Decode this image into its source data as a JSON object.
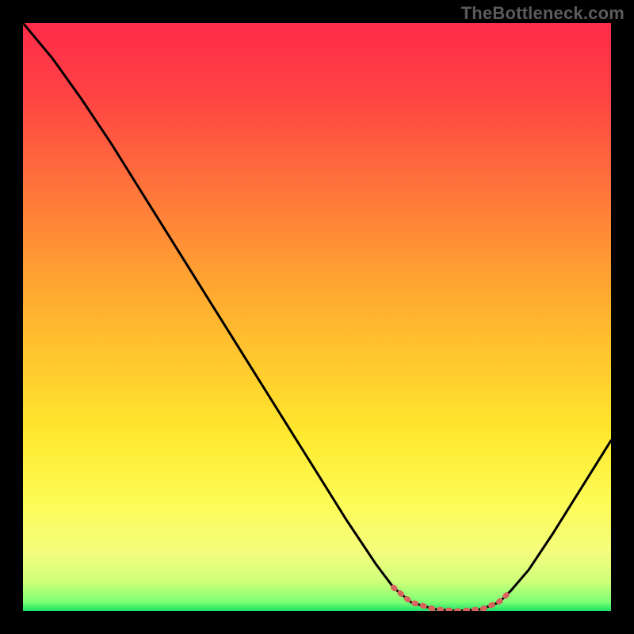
{
  "watermark": "TheBottleneck.com",
  "chart_data": {
    "type": "line",
    "title": "",
    "xlabel": "",
    "ylabel": "",
    "xlim": [
      0,
      100
    ],
    "ylim": [
      0,
      100
    ],
    "grid": false,
    "x": [
      0,
      5,
      10,
      15,
      20,
      25,
      30,
      35,
      40,
      45,
      50,
      55,
      60,
      63,
      66,
      70,
      74,
      78,
      81,
      83,
      86,
      90,
      95,
      100
    ],
    "y": [
      100,
      94,
      87,
      79.5,
      71.5,
      63.5,
      55.5,
      47.5,
      39.5,
      31.5,
      23.5,
      15.5,
      8,
      4,
      1.5,
      0.3,
      0.0,
      0.3,
      1.5,
      3.5,
      7,
      13,
      21,
      29
    ],
    "note": "Values are approximate readings from an unlabeled gradient chart; y=0 at bottom, y=100 at top; x=0 at left, x=100 at right.",
    "flat_segment": {
      "x_start": 63,
      "x_end": 83,
      "color": "#d9645e",
      "style": "dotted"
    },
    "gradient_stops": [
      {
        "offset": 0.0,
        "color": "#ff2b4a"
      },
      {
        "offset": 0.12,
        "color": "#ff4244"
      },
      {
        "offset": 0.25,
        "color": "#ff6a3d"
      },
      {
        "offset": 0.4,
        "color": "#ff9933"
      },
      {
        "offset": 0.55,
        "color": "#ffc22e"
      },
      {
        "offset": 0.7,
        "color": "#ffe92e"
      },
      {
        "offset": 0.82,
        "color": "#fdfc58"
      },
      {
        "offset": 0.9,
        "color": "#f4fd7d"
      },
      {
        "offset": 0.95,
        "color": "#cfff7a"
      },
      {
        "offset": 0.985,
        "color": "#7bff74"
      },
      {
        "offset": 1.0,
        "color": "#19e267"
      }
    ],
    "curve_color": "#000000"
  }
}
